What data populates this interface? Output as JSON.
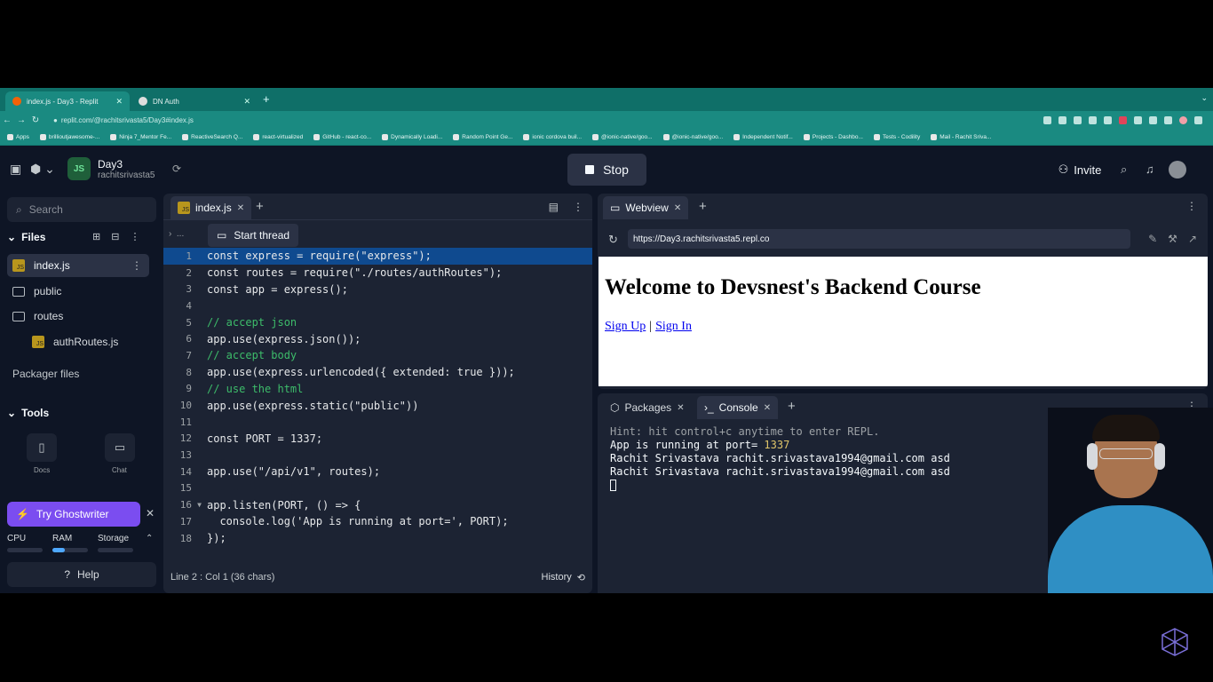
{
  "browser": {
    "tabs": [
      {
        "title": "index.js - Day3 - Replit"
      },
      {
        "title": "DN Auth"
      }
    ],
    "url": "replit.com/@rachitsrivasta5/Day3#index.js",
    "bookmarks": [
      "Apps",
      "brillioutjawesome-...",
      "Ninja 7_Mentor Fe...",
      "ReactiveSearch Q...",
      "react-virtualized",
      "GitHub - react-co...",
      "Dynamically Loadi...",
      "Random Point Ge...",
      "ionic cordova buil...",
      "@ionic-native/goo...",
      "@ionic-native/goo...",
      "Independent Notif...",
      "Projects - Dashbo...",
      "Tests - Codility",
      "Mail - Rachit Sriva..."
    ]
  },
  "header": {
    "project_name": "Day3",
    "owner": "rachitsrivasta5",
    "stop_label": "Stop",
    "invite_label": "Invite"
  },
  "sidebar": {
    "search_placeholder": "Search",
    "files_label": "Files",
    "files": [
      {
        "name": "index.js",
        "type": "js"
      },
      {
        "name": "public",
        "type": "folder"
      },
      {
        "name": "routes",
        "type": "folder"
      },
      {
        "name": "authRoutes.js",
        "type": "js"
      }
    ],
    "packager_label": "Packager files",
    "tools_label": "Tools",
    "tools": [
      {
        "label": "Docs"
      },
      {
        "label": "Chat"
      }
    ],
    "ghostwriter_label": "Try Ghostwriter",
    "resources": [
      {
        "label": "CPU",
        "usage": 0
      },
      {
        "label": "RAM",
        "usage": 0.35
      },
      {
        "label": "Storage",
        "usage": 0
      }
    ],
    "help_label": "Help"
  },
  "editor": {
    "tab_label": "index.js",
    "thread_label": "Start thread",
    "crumb": "...",
    "lines": [
      {
        "n": "1",
        "text": "const express = require(\"express\");",
        "kind": "code"
      },
      {
        "n": "2",
        "text": "const routes = require(\"./routes/authRoutes\");",
        "kind": "code"
      },
      {
        "n": "3",
        "text": "const app = express();",
        "kind": "code"
      },
      {
        "n": "4",
        "text": "",
        "kind": "code"
      },
      {
        "n": "5",
        "text": "// accept json",
        "kind": "comment"
      },
      {
        "n": "6",
        "text": "app.use(express.json());",
        "kind": "code"
      },
      {
        "n": "7",
        "text": "// accept body",
        "kind": "comment"
      },
      {
        "n": "8",
        "text": "app.use(express.urlencoded({ extended: true }));",
        "kind": "code"
      },
      {
        "n": "9",
        "text": "// use the html",
        "kind": "comment"
      },
      {
        "n": "10",
        "text": "app.use(express.static(\"public\"))",
        "kind": "code"
      },
      {
        "n": "11",
        "text": "",
        "kind": "code"
      },
      {
        "n": "12",
        "text": "const PORT = 1337;",
        "kind": "code"
      },
      {
        "n": "13",
        "text": "",
        "kind": "code"
      },
      {
        "n": "14",
        "text": "app.use(\"/api/v1\", routes);",
        "kind": "code"
      },
      {
        "n": "15",
        "text": "",
        "kind": "code"
      },
      {
        "n": "16",
        "text": "app.listen(PORT, () => {",
        "kind": "code"
      },
      {
        "n": "17",
        "text": "  console.log('App is running at port=', PORT);",
        "kind": "code"
      },
      {
        "n": "18",
        "text": "});",
        "kind": "code"
      }
    ],
    "status": "Line 2 : Col 1 (36 chars)",
    "history_label": "History"
  },
  "webview": {
    "tab_label": "Webview",
    "url": "https://Day3.rachitsrivasta5.repl.co",
    "heading": "Welcome to Devsnest's Backend Course",
    "links": [
      "Sign Up",
      "Sign In"
    ],
    "separator": "|"
  },
  "console": {
    "packages_label": "Packages",
    "console_label": "Console",
    "hint": "Hint: hit control+c anytime to enter REPL.",
    "running_prefix": "App is running at port= ",
    "port": "1337",
    "log_lines": [
      "Rachit Srivastava rachit.srivastava1994@gmail.com asd",
      "Rachit Srivastava rachit.srivastava1994@gmail.com asd"
    ]
  },
  "colors": {
    "app_bg": "#0e1525",
    "panel_bg": "#1c2333",
    "accent": "#7b4df0",
    "selection": "#0f4a8f",
    "browser_chrome": "#1a8a81"
  }
}
